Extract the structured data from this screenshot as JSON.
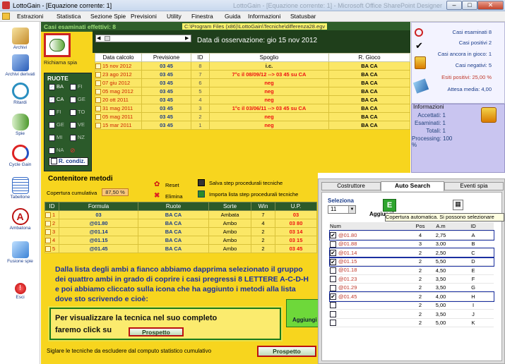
{
  "window": {
    "title": "LottoGain - [Equazione corrente: 1]",
    "faded_title": "LottoGain - [Equazione corrente: 1]   -   Microsoft Office SharePoint Designer"
  },
  "menu": [
    "Estrazioni",
    "Statistica",
    "Sezione Spie",
    "Previsioni",
    "Utility",
    "Finestra",
    "Guida",
    "Informazioni",
    "Statusbar"
  ],
  "sidebar": [
    "Archivi",
    "Archivi derivati",
    "Ritardi",
    "Spie",
    "Cycle Gain",
    "Tabellone",
    "Ambatona",
    "Fusione spie",
    "Esci"
  ],
  "top": {
    "casi_label": "Casi esaminati effettivi: 8",
    "path": "C:\\Program Files (x86)\\LottoGain\\Tecniche\\differenza28.egv",
    "obs_date": "Data di osservazione:  gio 15 nov 2012",
    "richiama": "Richiama spia",
    "headers": [
      "Data calcolo",
      "Previsione",
      "ID",
      "Spoglio",
      "R. Gioco"
    ],
    "rows": [
      [
        "15 nov 2012",
        "03 45",
        "8",
        "i.c.",
        "BA CA"
      ],
      [
        "23 ago 2012",
        "03 45",
        "7",
        "7°c il 08/09/12 --> 03 45 su CA",
        "BA CA"
      ],
      [
        "07 giu 2012",
        "03 45",
        "6",
        "neg",
        "BA CA"
      ],
      [
        "05 mag 2012",
        "03 45",
        "5",
        "neg",
        "BA CA"
      ],
      [
        "20 ott 2011",
        "03 45",
        "4",
        "neg",
        "BA CA"
      ],
      [
        "31 mag 2011",
        "03 45",
        "3",
        "1°c il 03/06/11 --> 03 45 su CA",
        "BA CA"
      ],
      [
        "05 mag 2011",
        "03 45",
        "2",
        "neg",
        "BA CA"
      ],
      [
        "15 mar 2011",
        "03 45",
        "1",
        "neg",
        "BA CA"
      ]
    ],
    "ruote_title": "RUOTE",
    "ruote": [
      [
        "BA",
        "FI"
      ],
      [
        "CA",
        "GE"
      ],
      [
        "FI",
        "TO"
      ],
      [
        "GE",
        "VE"
      ],
      [
        "MI",
        "NZ"
      ],
      [
        "NA",
        ""
      ]
    ],
    "ruote_checked": [
      "BA",
      "CA"
    ],
    "r_condiz": "R. condiz."
  },
  "info": {
    "lines": [
      "Casi esaminati 8",
      "Casi positivi 2",
      "Casi ancora in gioco: 1",
      "Casi negativi: 5",
      "Esiti positivi: 25,00 %",
      "Attesa media: 4,00"
    ],
    "title": "Informazioni",
    "stats": [
      "Accettati: 1",
      "Esaminati: 1",
      "Totali: 1",
      "Processing:  100 %"
    ]
  },
  "contenitore": {
    "title": "Contenitore metodi",
    "coverage_label": "Copertura cumulativa",
    "coverage_value": "87,50 %",
    "reset": "Reset",
    "elimina": "Elimina",
    "salva": "Salva step procedurali tecniche",
    "importa": "Importa lista step procedurali tecniche",
    "headers": [
      "ID",
      "Formula",
      "Ruote",
      "Sorte",
      "Win",
      "U.P."
    ],
    "rows": [
      [
        "1",
        "03",
        "BA CA",
        "Ambata",
        "7",
        "03"
      ],
      [
        "2",
        "@01.80",
        "BA CA",
        "Ambo",
        "4",
        "03 80"
      ],
      [
        "3",
        "@01.14",
        "BA CA",
        "Ambo",
        "2",
        "03 14"
      ],
      [
        "4",
        "@01.15",
        "BA CA",
        "Ambo",
        "2",
        "03 15"
      ],
      [
        "5",
        "@01.45",
        "BA CA",
        "Ambo",
        "2",
        "03 45"
      ]
    ],
    "note": "Dalla lista degli ambi a fianco abbiamo dapprima selezionato il gruppo dei quattro ambi in grado di coprire i casi pregressi 8 LETTERE A-C-D-H  e poi abbiamo cliccato sulla icona che ha aggiunto i metodi alla lista dove sto scrivendo e cioè:",
    "callout": "Per visualizzare la tecnica nel suo completo",
    "callout2": "faremo click su",
    "prospetto": "Prospetto",
    "footer": "Siglare le tecniche da escludere dal computo statistico cumulativo"
  },
  "right": {
    "tabs": [
      "Costruttore",
      "Auto Search",
      "Eventi spia"
    ],
    "seleziona": "Seleziona",
    "sel_value": "11",
    "aggiungi": "Aggiungi",
    "tooltip": "Copertura automatica. Si possono selezionare",
    "headers": [
      "Num",
      "Pos",
      "A.m",
      "ID"
    ],
    "rows": [
      [
        "@01.80",
        "4",
        "2,75",
        "A",
        true
      ],
      [
        "@01.88",
        "3",
        "3,00",
        "B",
        false
      ],
      [
        "@01.14",
        "2",
        "2,50",
        "C",
        true
      ],
      [
        "@01.15",
        "2",
        "5,50",
        "D",
        true
      ],
      [
        "@01.18",
        "2",
        "4,50",
        "E",
        false
      ],
      [
        "@01.23",
        "2",
        "3,50",
        "F",
        false
      ],
      [
        "@01.29",
        "2",
        "3,50",
        "G",
        false
      ],
      [
        "@01.45",
        "2",
        "4,00",
        "H",
        true
      ],
      [
        "",
        "2",
        "5,00",
        "I",
        false
      ],
      [
        "",
        "2",
        "3,50",
        "J",
        false
      ],
      [
        "",
        "2",
        "5,00",
        "K",
        false
      ]
    ],
    "multi": "Aggiungi multi metodo"
  }
}
